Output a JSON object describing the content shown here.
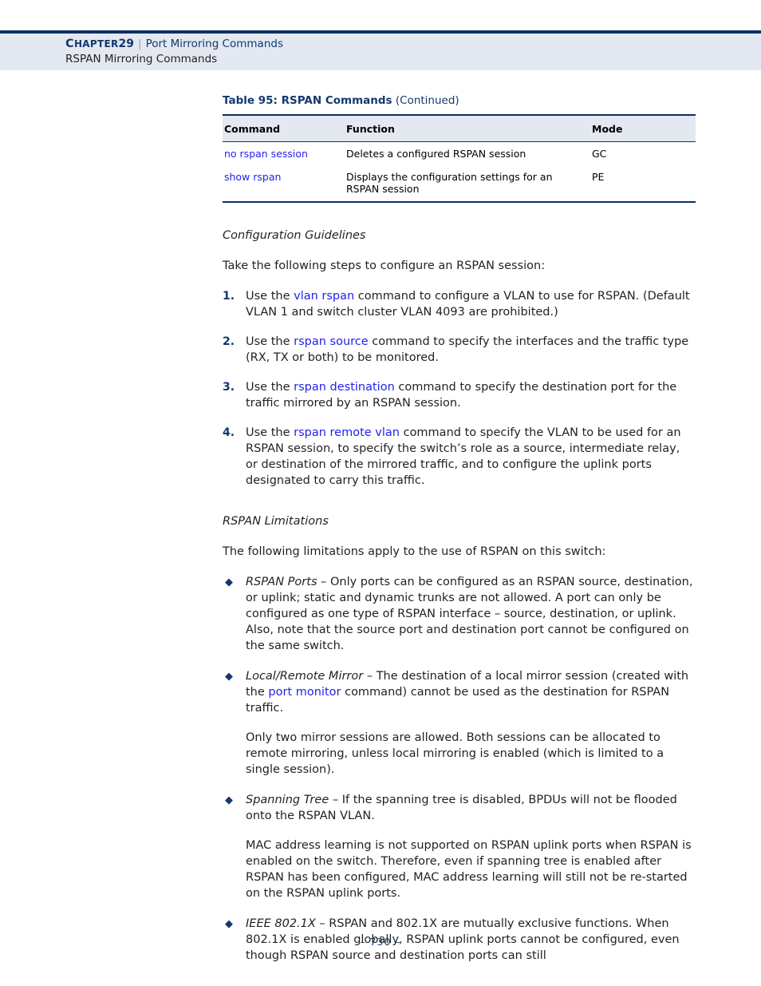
{
  "header": {
    "chapter_word": "Chapter",
    "chapter_number": "29",
    "separator": "|",
    "subject": "Port Mirroring Commands",
    "subtitle": "RSPAN Mirroring Commands"
  },
  "table": {
    "caption_main": "Table 95: RSPAN Commands",
    "caption_continued": "(Continued)",
    "columns": [
      "Command",
      "Function",
      "Mode"
    ],
    "rows": [
      {
        "command": "no rspan session",
        "function": "Deletes a configured RSPAN session",
        "mode": "GC"
      },
      {
        "command": "show rspan",
        "function": "Displays the configuration settings for an RSPAN session",
        "mode": "PE"
      }
    ]
  },
  "config_guidelines": {
    "heading": "Configuration Guidelines",
    "intro": "Take the following steps to configure an RSPAN session:",
    "steps": [
      {
        "number": "1.",
        "pre": "Use the ",
        "link": "vlan rspan",
        "post": " command to configure a VLAN to use for RSPAN. (Default VLAN 1 and switch cluster VLAN 4093 are prohibited.)"
      },
      {
        "number": "2.",
        "pre": "Use the ",
        "link": "rspan source",
        "post": " command to specify the interfaces and the traffic type (RX, TX or both) to be monitored."
      },
      {
        "number": "3.",
        "pre": "Use the ",
        "link": "rspan destination",
        "post": " command to specify the destination port for the traffic mirrored by an RSPAN session."
      },
      {
        "number": "4.",
        "pre": "Use the ",
        "link": "rspan remote vlan",
        "post": " command to specify the VLAN to be used for an RSPAN session, to specify the switch’s role as a source, intermediate relay, or destination of the mirrored traffic, and to configure the uplink ports designated to carry this traffic."
      }
    ]
  },
  "limitations": {
    "heading": "RSPAN Limitations",
    "intro": "The following limitations apply to the use of RSPAN on this switch:",
    "items": [
      {
        "term": "RSPAN Ports",
        "dash": " – ",
        "pre": "Only ports can be configured as an RSPAN source, destination, or uplink; static and dynamic trunks are not allowed. A port can only be configured as one type of RSPAN interface – source, destination, or uplink. Also, note that the source port and destination port cannot be configured on the same switch.",
        "link": "",
        "post": "",
        "sub": ""
      },
      {
        "term": "Local/Remote Mirror",
        "dash": " – ",
        "pre": "The destination of a local mirror session (created with the ",
        "link": "port monitor",
        "post": " command) cannot be used as the destination for RSPAN traffic.",
        "sub": "Only two mirror sessions are allowed. Both sessions can be allocated to remote mirroring, unless local mirroring is enabled (which is limited to a single session)."
      },
      {
        "term": "Spanning Tree",
        "dash": " – ",
        "pre": "If the spanning tree is disabled, BPDUs will not be flooded onto the RSPAN VLAN.",
        "link": "",
        "post": "",
        "sub": "MAC address learning is not supported on RSPAN uplink ports when RSPAN is enabled on the switch. Therefore, even if spanning tree is enabled after RSPAN has been configured, MAC address learning will still not be re-started on the RSPAN uplink ports."
      },
      {
        "term": "IEEE 802.1X",
        "dash": " – ",
        "pre": "RSPAN and 802.1X are mutually exclusive functions. When 802.1X is enabled globally, RSPAN uplink ports cannot be configured, even though RSPAN source and destination ports can still",
        "link": "",
        "post": "",
        "sub": ""
      }
    ]
  },
  "footer": {
    "page_label": "–  730  –"
  },
  "colors": {
    "navy": "#14386e",
    "rule_navy": "#0b3064",
    "band": "#e3e8f1",
    "link_blue": "#2222ee",
    "body_text": "#231f20"
  }
}
